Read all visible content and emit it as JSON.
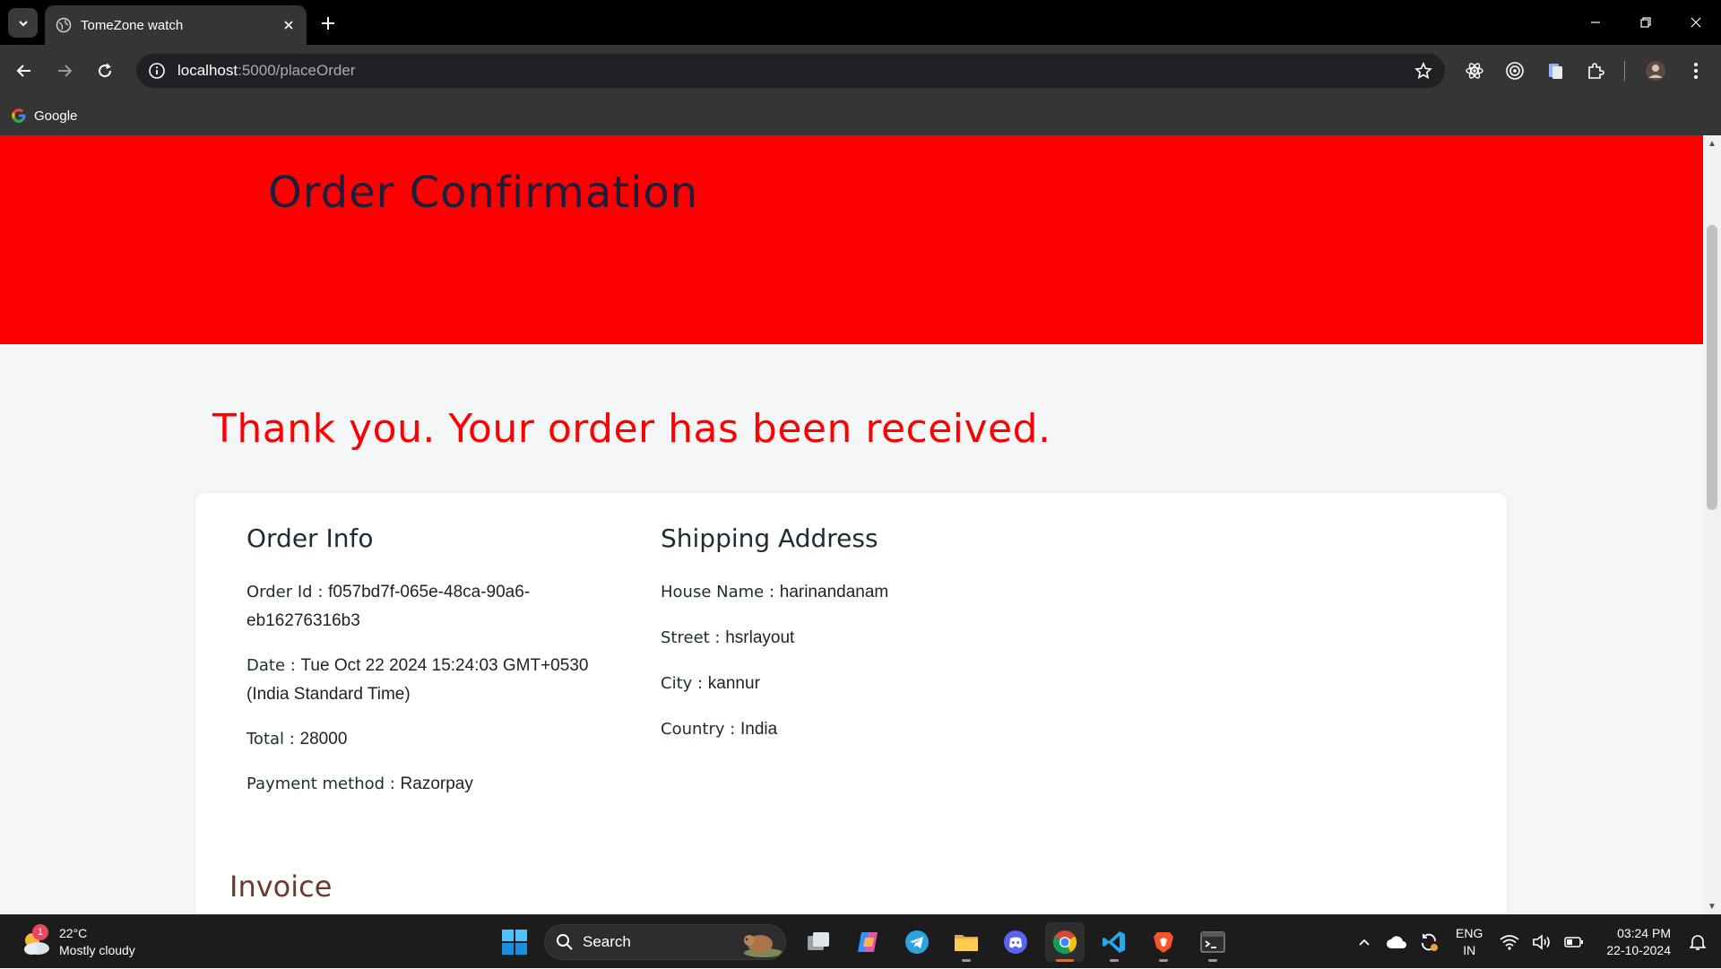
{
  "browser": {
    "tab_title": "TomeZone watch",
    "url_host": "localhost",
    "url_rest": ":5000/placeOrder",
    "bookmark_label": "Google"
  },
  "page": {
    "hero_title": "Order Confirmation",
    "thanks_message": "Thank you. Your order has been received.",
    "order_info": {
      "heading": "Order Info",
      "order_id_label": "Order Id : ",
      "order_id": "f057bd7f-065e-48ca-90a6-eb16276316b3",
      "date_label": "Date : ",
      "date": "Tue Oct 22 2024 15:24:03 GMT+0530 (India Standard Time)",
      "total_label": "Total : ",
      "total": "28000",
      "payment_label": "Payment method : ",
      "payment": "Razorpay"
    },
    "shipping": {
      "heading": "Shipping Address",
      "house_label": "House Name : ",
      "house": "harinandanam",
      "street_label": "Street : ",
      "street": "hsrlayout",
      "city_label": "City : ",
      "city": "kannur",
      "country_label": "Country : ",
      "country": "India"
    },
    "invoice_heading": "Invoice"
  },
  "taskbar": {
    "weather_badge": "1",
    "temperature": "22°C",
    "weather_desc": "Mostly cloudy",
    "search_label": "Search",
    "lang_top": "ENG",
    "lang_bottom": "IN",
    "time": "03:24 PM",
    "date": "22-10-2024"
  },
  "colors": {
    "hero_bg": "#ff0000",
    "thanks_text": "#ff0000",
    "invoice_text": "#6b3a2a"
  }
}
